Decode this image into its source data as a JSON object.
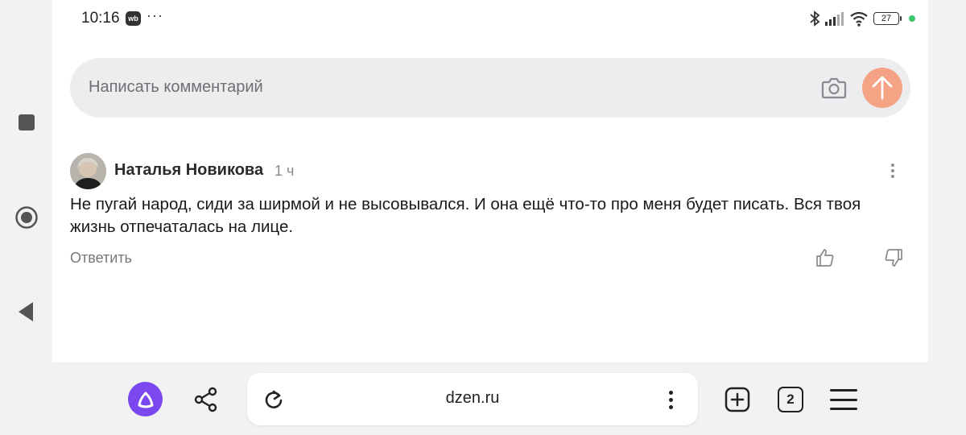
{
  "status_bar": {
    "time": "10:16",
    "app_badge": "wb",
    "more": "···",
    "battery": "27"
  },
  "comment_input": {
    "placeholder": "Написать комментарий"
  },
  "comment": {
    "author": "Наталья Новикова",
    "time": "1 ч",
    "text": "Не пугай народ, сиди за ширмой и не высовывался. И она ещё что-то про меня будет писать. Вся твоя жизнь отпечаталась на лице.",
    "reply_label": "Ответить"
  },
  "browser": {
    "url": "dzen.ru",
    "tab_count": "2"
  },
  "colors": {
    "send_button": "#f4a484",
    "alice_button": "#7b48f0",
    "status_dot": "#3cc46a"
  }
}
